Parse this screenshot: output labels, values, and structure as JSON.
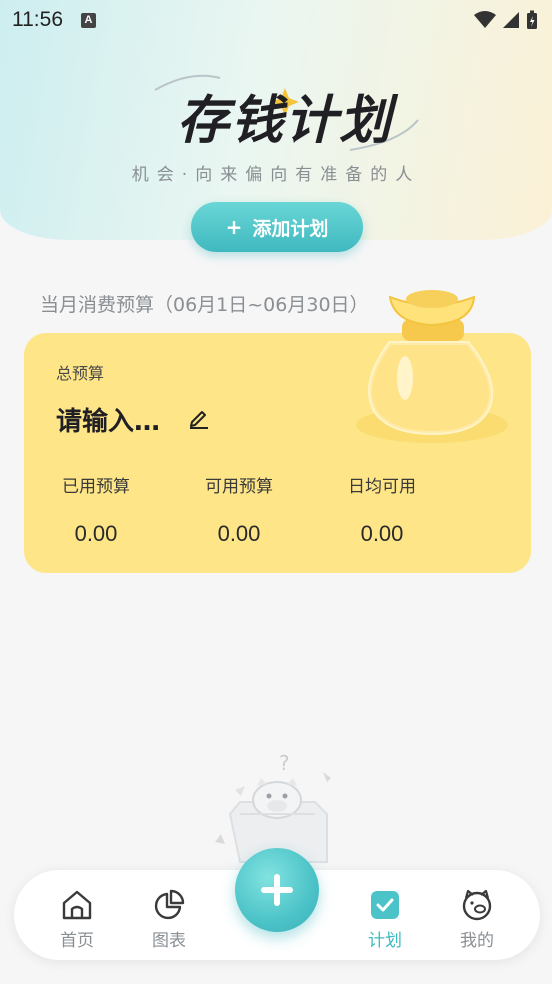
{
  "status_bar": {
    "time": "11:56",
    "notif_icon": "a-icon"
  },
  "header": {
    "logo_text": "存钱计划",
    "slogan": "机会·向来偏向有准备的人",
    "add_plan_plus": "+",
    "add_plan_label": "添加计划"
  },
  "budget": {
    "period_label": "当月消费预算（06月1日~06月30日）",
    "total_label": "总预算",
    "total_value": "请输入…",
    "stats": [
      {
        "label": "已用预算",
        "value": "0.00"
      },
      {
        "label": "可用预算",
        "value": "0.00"
      },
      {
        "label": "日均可用",
        "value": "0.00"
      }
    ]
  },
  "tabbar": {
    "tabs": [
      {
        "label": "首页",
        "icon": "home-icon",
        "active": false
      },
      {
        "label": "图表",
        "icon": "pie-chart-icon",
        "active": false
      },
      {
        "label": "计划",
        "icon": "checkbox-icon",
        "active": true
      },
      {
        "label": "我的",
        "icon": "pig-face-icon",
        "active": false
      }
    ],
    "fab_icon": "plus-icon"
  },
  "colors": {
    "accent": "#3fb9c0",
    "card_bg": "#fde588",
    "page_bg": "#f6f6f7"
  }
}
